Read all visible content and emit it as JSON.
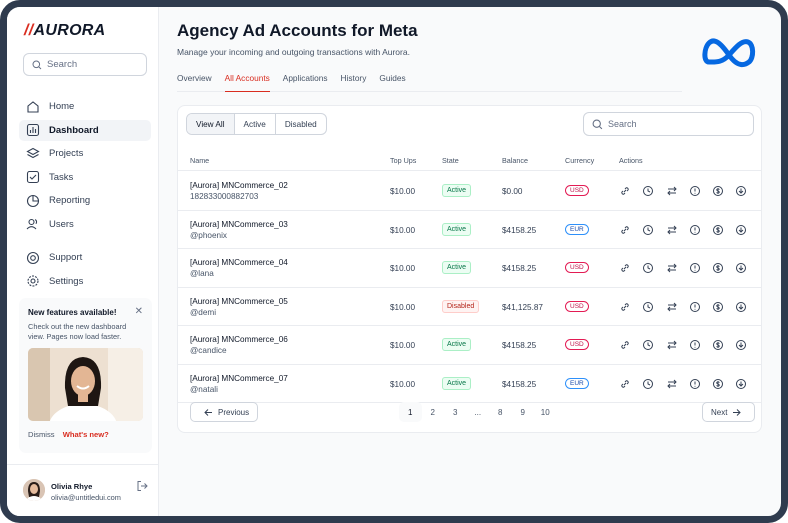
{
  "brand": {
    "name": "AURORA",
    "slash": "//"
  },
  "sidebar": {
    "search_placeholder": "Search",
    "nav": [
      {
        "label": "Home",
        "icon": "home-icon"
      },
      {
        "label": "Dashboard",
        "icon": "bar-chart-icon",
        "active": true
      },
      {
        "label": "Projects",
        "icon": "layers-icon"
      },
      {
        "label": "Tasks",
        "icon": "check-square-icon"
      },
      {
        "label": "Reporting",
        "icon": "pie-chart-icon"
      },
      {
        "label": "Users",
        "icon": "users-icon"
      }
    ],
    "nav2": [
      {
        "label": "Support",
        "icon": "life-buoy-icon"
      },
      {
        "label": "Settings",
        "icon": "gear-icon"
      }
    ],
    "feature": {
      "title": "New features available!",
      "text": "Check out the new dashboard view. Pages now load faster.",
      "dismiss": "Dismiss",
      "whats_new": "What's new?"
    },
    "user": {
      "name": "Olivia Rhye",
      "email": "olivia@untitledui.com"
    }
  },
  "header": {
    "title": "Agency Ad Accounts for Meta",
    "subtitle": "Manage your incoming and outgoing transactions with Aurora.",
    "tabs": [
      "Overview",
      "All Accounts",
      "Applications",
      "History",
      "Guides"
    ],
    "active_tab": 1
  },
  "filters": {
    "options": [
      "View All",
      "Active",
      "Disabled"
    ],
    "active": 0,
    "search_placeholder": "Search"
  },
  "table": {
    "columns": [
      "Name",
      "Top Ups",
      "State",
      "Balance",
      "Currency",
      "Actions"
    ],
    "rows": [
      {
        "name": "[Aurora] MNCommerce_02",
        "sub": "182833000882703",
        "topup": "$10.00",
        "state": "Active",
        "balance": "$0.00",
        "currency": "USD"
      },
      {
        "name": "[Aurora] MNCommerce_03",
        "sub": "@phoenix",
        "topup": "$10.00",
        "state": "Active",
        "balance": "$4158.25",
        "currency": "EUR"
      },
      {
        "name": "[Aurora] MNCommerce_04",
        "sub": "@lana",
        "topup": "$10.00",
        "state": "Active",
        "balance": "$4158.25",
        "currency": "USD"
      },
      {
        "name": "[Aurora] MNCommerce_05",
        "sub": "@demi",
        "topup": "$10.00",
        "state": "Disabled",
        "balance": "$41,125.87",
        "currency": "USD"
      },
      {
        "name": "[Aurora] MNCommerce_06",
        "sub": "@candice",
        "topup": "$10.00",
        "state": "Active",
        "balance": "$4158.25",
        "currency": "USD"
      },
      {
        "name": "[Aurora] MNCommerce_07",
        "sub": "@natali",
        "topup": "$10.00",
        "state": "Active",
        "balance": "$4158.25",
        "currency": "EUR"
      }
    ],
    "action_icons": [
      "link-icon",
      "history-icon",
      "transfer-icon",
      "info-icon",
      "dollar-icon",
      "download-icon"
    ]
  },
  "pagination": {
    "previous": "Previous",
    "next": "Next",
    "pages": [
      "1",
      "2",
      "3",
      "...",
      "8",
      "9",
      "10"
    ],
    "active": "1"
  }
}
